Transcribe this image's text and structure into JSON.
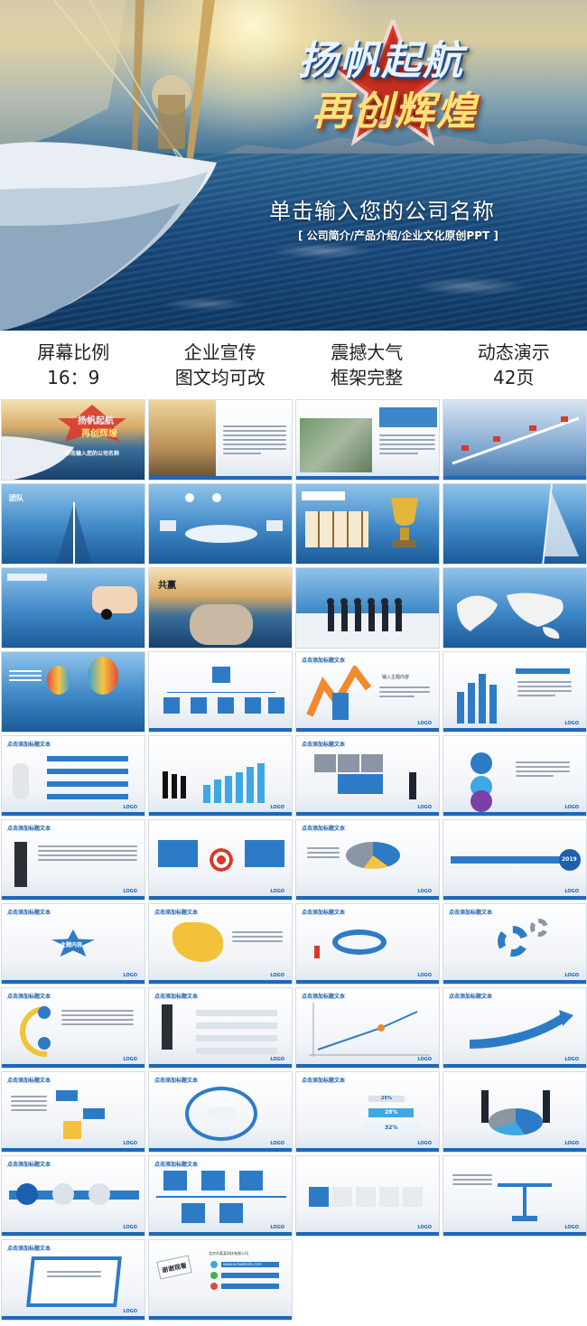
{
  "hero": {
    "title_line1": "扬帆起航",
    "title_line2": "再创辉煌",
    "company": "单击输入您的公司名称",
    "subtitle": "[ 公司简介/产品介绍/企业文化原创PPT ]"
  },
  "features": [
    {
      "line1": "屏幕比例",
      "line2": "16：9"
    },
    {
      "line1": "企业宣传",
      "line2": "图文均可改"
    },
    {
      "line1": "震撼大气",
      "line2": "框架完整"
    },
    {
      "line1": "动态演示",
      "line2": "42页"
    }
  ],
  "slide_text": {
    "click_title": "点击添加标题文本",
    "logo": "LOGO",
    "input_topic": "输入主题内容",
    "main_content": "主题内容",
    "thanks": "谢谢观看",
    "company_full": "北京市某某科技有限公司",
    "website": "www.ourwebsite.com",
    "year_2019": "2019",
    "pct_25": "25%",
    "pct_28": "28%",
    "pct_32": "32%"
  },
  "colors": {
    "brand_blue": "#1e5fae",
    "accent_yellow": "#ffe27a",
    "accent_red": "#d93a2b"
  }
}
